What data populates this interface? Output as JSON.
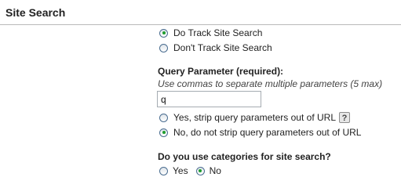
{
  "header": {
    "title": "Site Search"
  },
  "tracking": {
    "options": [
      {
        "label": "Do Track Site Search",
        "checked": true
      },
      {
        "label": "Don't Track Site Search",
        "checked": false
      }
    ]
  },
  "query_parameter": {
    "label": "Query Parameter (required):",
    "hint": "Use commas to separate multiple parameters (5 max)",
    "value": "q"
  },
  "strip": {
    "options": [
      {
        "label": "Yes, strip query parameters out of URL",
        "checked": false
      },
      {
        "label": "No, do not strip query parameters out of URL",
        "checked": true
      }
    ],
    "help_icon": "question-mark-icon",
    "help_glyph": "?"
  },
  "categories": {
    "question": "Do you use categories for site search?",
    "options": [
      {
        "label": "Yes",
        "checked": false
      },
      {
        "label": "No",
        "checked": true
      }
    ]
  },
  "colors": {
    "radio_dot": "#1f9d2e",
    "divider": "#b9b9b9"
  }
}
